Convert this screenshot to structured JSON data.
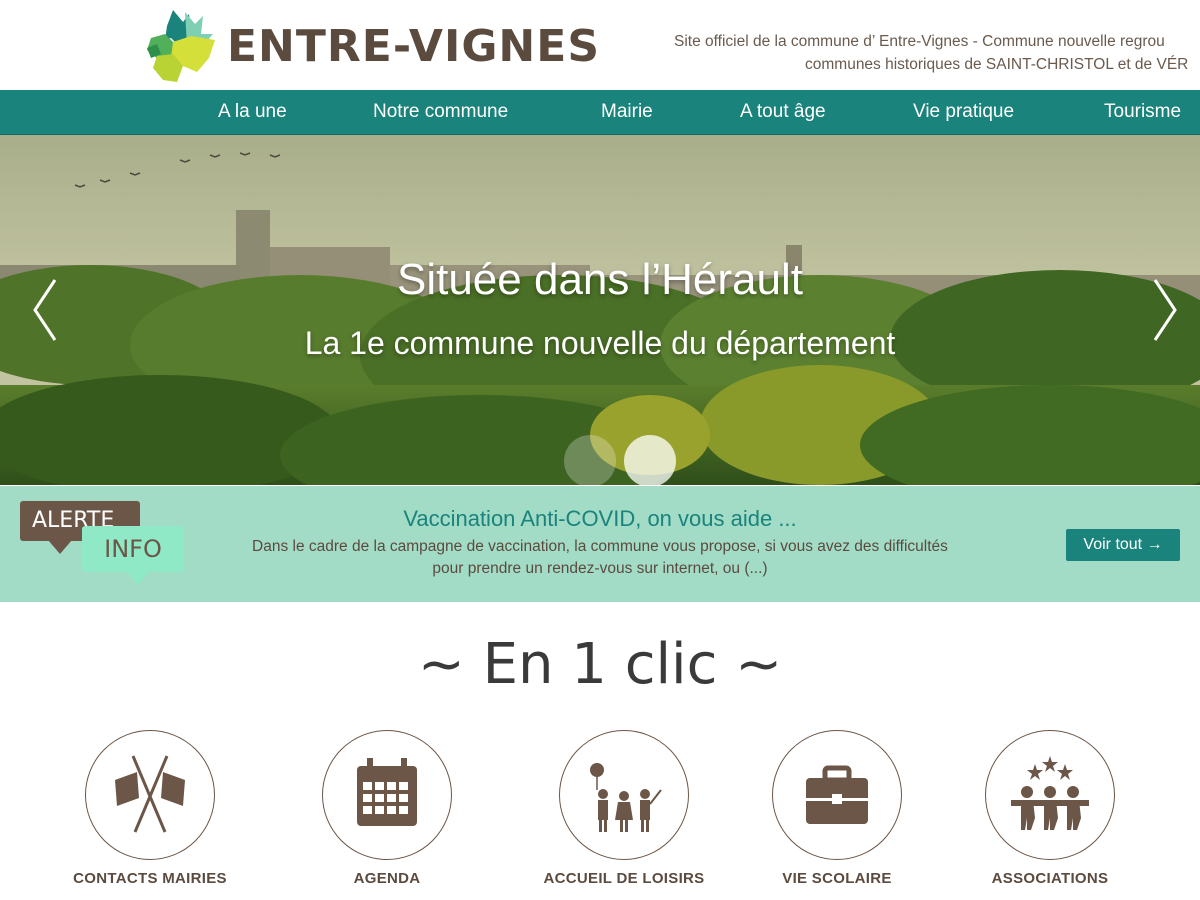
{
  "site": {
    "logo_text": "ENTRE-VIGNES",
    "tagline_line1": "Site officiel de la commune d’ Entre-Vignes - Commune nouvelle regrou",
    "tagline_line2": "communes historiques de SAINT-CHRISTOL et de VÉR"
  },
  "nav": {
    "items": [
      {
        "label": "A la une"
      },
      {
        "label": "Notre commune"
      },
      {
        "label": "Mairie"
      },
      {
        "label": "A tout âge"
      },
      {
        "label": "Vie pratique"
      },
      {
        "label": "Tourisme"
      }
    ]
  },
  "hero": {
    "title": "Située dans l’Hérault",
    "subtitle": "La 1e commune nouvelle du département",
    "active_slide": 2,
    "slide_count": 2
  },
  "alert": {
    "badge_top": "ALERTE",
    "badge_bottom": "INFO",
    "title": "Vaccination Anti-COVID, on vous aide ...",
    "text": "Dans le cadre de la campagne de vaccination, la commune vous propose, si vous avez des difficultés pour prendre un rendez-vous sur internet, ou (...)",
    "button_label": "Voir tout  →"
  },
  "quick_links": {
    "title": "~ En 1 clic ~",
    "items": [
      {
        "label": "CONTACTS MAIRIES",
        "icon": "flags-icon"
      },
      {
        "label": "AGENDA",
        "icon": "calendar-icon"
      },
      {
        "label": "ACCUEIL DE LOISIRS",
        "icon": "children-icon"
      },
      {
        "label": "VIE SCOLAIRE",
        "icon": "briefcase-icon"
      },
      {
        "label": "ASSOCIATIONS",
        "icon": "people-stars-icon"
      }
    ]
  },
  "colors": {
    "brand_brown": "#5b4a3e",
    "nav_teal": "#1a837b",
    "alert_mint": "#a2dcc7",
    "badge_mint": "#8fe9c6"
  }
}
